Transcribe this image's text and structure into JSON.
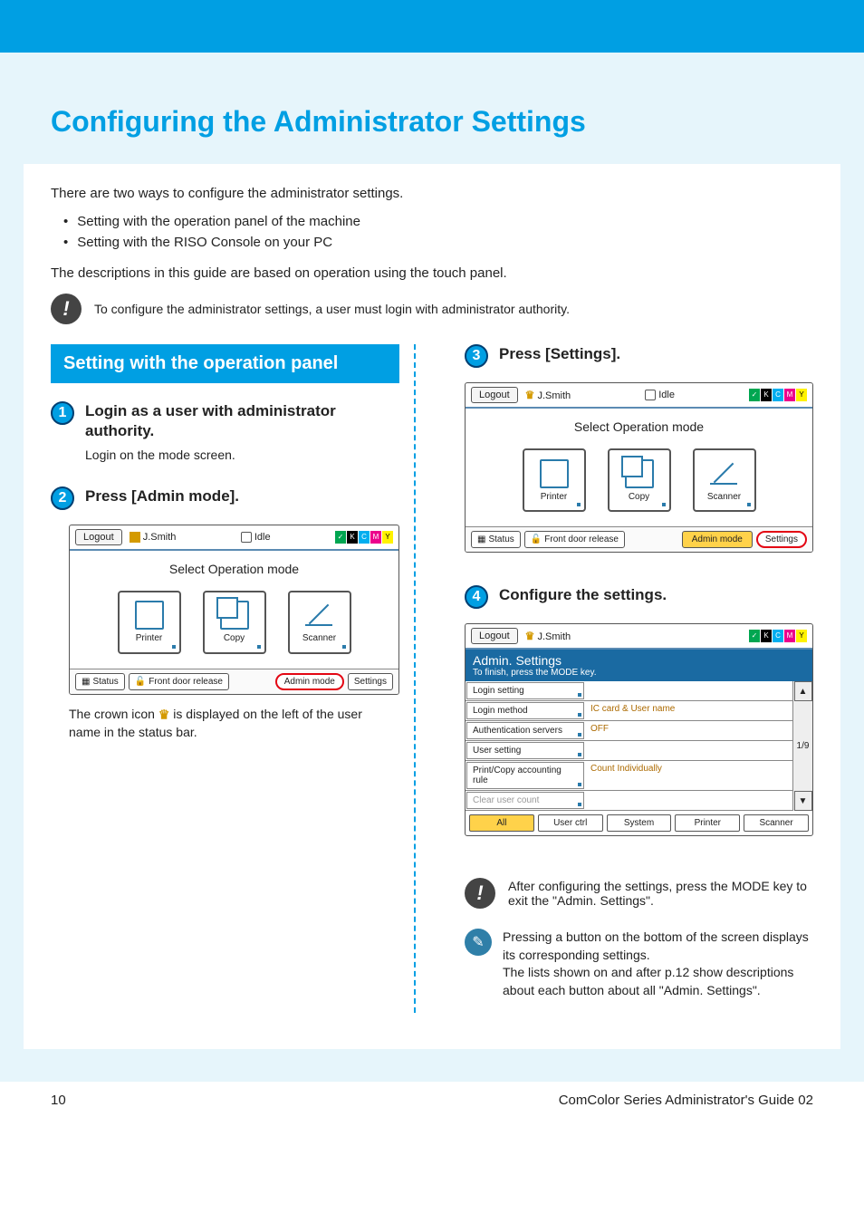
{
  "page": {
    "title": "Configuring the Administrator Settings",
    "intro1": "There are two ways to configure the administrator settings.",
    "bullets": [
      "Setting with the operation panel of the machine",
      "Setting with the RISO Console on your PC"
    ],
    "intro2": "The descriptions in this guide are based on operation using the touch panel.",
    "note1": "To configure the administrator settings, a user must login with administrator authority."
  },
  "section_header": "Setting with the operation panel",
  "steps": {
    "s1": {
      "num": "1",
      "title": "Login as a user with administrator authority.",
      "text": "Login on the mode screen."
    },
    "s2": {
      "num": "2",
      "title": "Press [Admin mode]."
    },
    "s3": {
      "num": "3",
      "title": "Press [Settings]."
    },
    "s4": {
      "num": "4",
      "title": "Configure the settings."
    }
  },
  "panel": {
    "logout": "Logout",
    "user": "J.Smith",
    "idle": "Idle",
    "ink": [
      "K",
      "C",
      "M",
      "Y"
    ],
    "mode_title": "Select Operation mode",
    "modes": {
      "printer": "Printer",
      "copy": "Copy",
      "scanner": "Scanner"
    },
    "bottom": {
      "status": "Status",
      "front_door": "Front door release",
      "admin_mode": "Admin mode",
      "settings": "Settings"
    }
  },
  "caption2": "The crown icon        is displayed on the left of the user name in the status bar.",
  "admin_panel": {
    "title": "Admin. Settings",
    "subtitle": "To finish, press the MODE key.",
    "rows": [
      {
        "label": "Login setting",
        "value": ""
      },
      {
        "label": "Login method",
        "value": "IC card & User name"
      },
      {
        "label": "Authentication servers",
        "value": "OFF"
      },
      {
        "label": "User setting",
        "value": ""
      },
      {
        "label": "Print/Copy accounting rule",
        "value": "Count Individually"
      },
      {
        "label": "Clear user count",
        "value": ""
      }
    ],
    "page": "1/9",
    "tabs": [
      "All",
      "User ctrl",
      "System",
      "Printer",
      "Scanner"
    ]
  },
  "note_after": "After configuring the settings, press the MODE key to exit the \"Admin. Settings\".",
  "tip1": "Pressing a button on the bottom of the screen displays its corresponding settings.",
  "tip2": "The lists shown on and after p.12 show descriptions about each button about all \"Admin. Settings\".",
  "footer": {
    "pagenum": "10",
    "guide": "ComColor Series  Administrator's Guide  02"
  }
}
